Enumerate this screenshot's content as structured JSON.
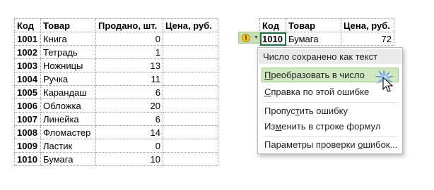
{
  "left_table": {
    "headers": [
      "Код",
      "Товар",
      "Продано, шт.",
      "Цена, руб."
    ],
    "rows": [
      {
        "code": "1001",
        "item": "Книга",
        "sold": "0",
        "price": ""
      },
      {
        "code": "1002",
        "item": "Тетрадь",
        "sold": "1",
        "price": ""
      },
      {
        "code": "1003",
        "item": "Ножницы",
        "sold": "13",
        "price": ""
      },
      {
        "code": "1004",
        "item": "Ручка",
        "sold": "11",
        "price": ""
      },
      {
        "code": "1005",
        "item": "Карандаш",
        "sold": "6",
        "price": ""
      },
      {
        "code": "1006",
        "item": "Обложка",
        "sold": "20",
        "price": ""
      },
      {
        "code": "1007",
        "item": "Линейка",
        "sold": "6",
        "price": ""
      },
      {
        "code": "1008",
        "item": "Фломастер",
        "sold": "14",
        "price": ""
      },
      {
        "code": "1009",
        "item": "Ластик",
        "sold": "0",
        "price": ""
      },
      {
        "code": "1010",
        "item": "Бумага",
        "sold": "10",
        "price": ""
      }
    ]
  },
  "right_table": {
    "headers": [
      "Код",
      "Товар",
      "Цена, руб."
    ],
    "row": {
      "code": "1010",
      "item": "Бумага",
      "price": "72"
    }
  },
  "smart_tag": {
    "icon": "warning-icon",
    "icon_glyph": "!",
    "chevron": "▼",
    "accent": "#c6dfb0"
  },
  "error_menu": {
    "title": "Число сохранено как текст",
    "items": [
      {
        "pre": "",
        "key": "П",
        "post": "реобразовать в число"
      },
      {
        "pre": "",
        "key": "С",
        "post": "правка по этой ошибке"
      },
      {
        "pre": "Пропус",
        "key": "т",
        "post": "ить ошибку"
      },
      {
        "pre": "Из",
        "key": "м",
        "post": "енить в строке формул"
      },
      {
        "pre": "Параметры проверки ",
        "key": "о",
        "post": "шибок..."
      }
    ],
    "highlight_color": "#cfe8c0"
  }
}
